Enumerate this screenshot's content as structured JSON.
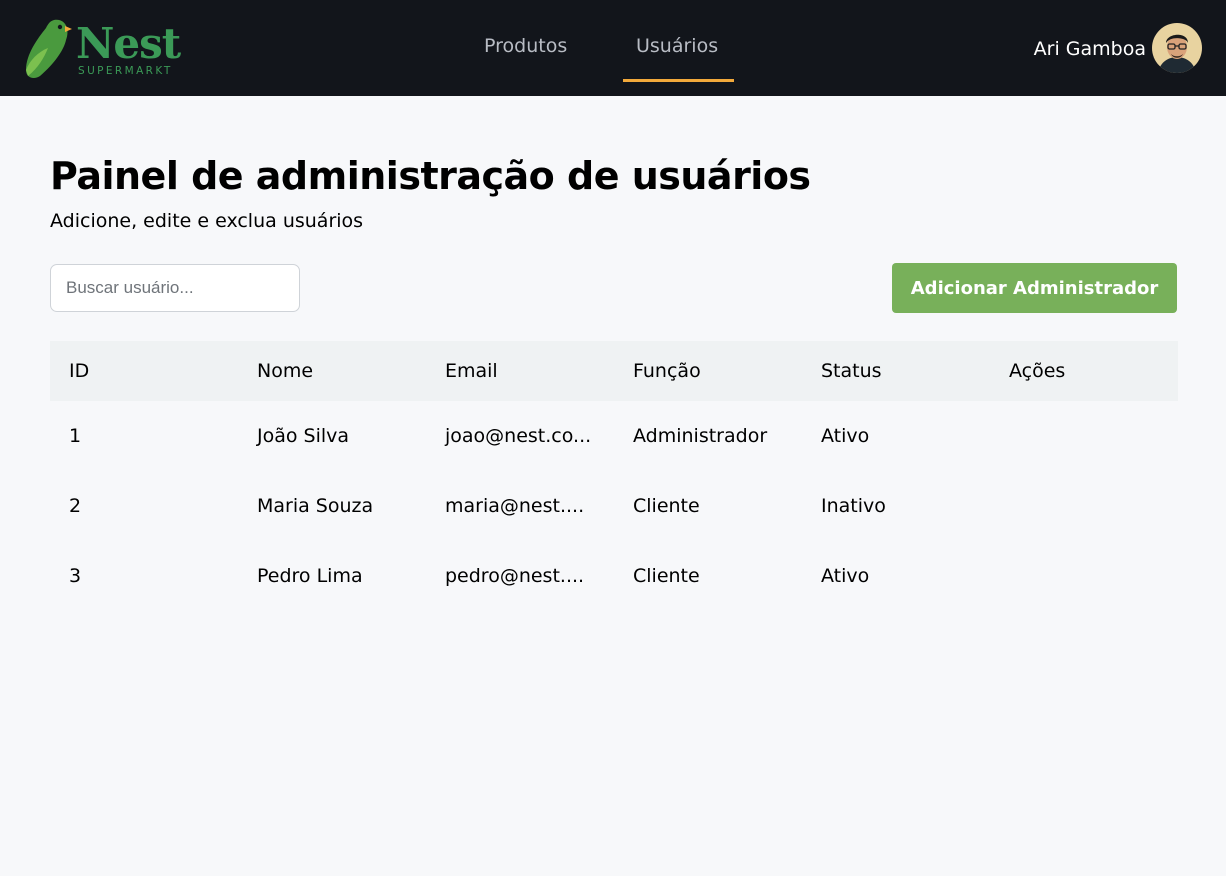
{
  "brand": {
    "name": "Nest",
    "tagline": "SUPERMARKT"
  },
  "nav": {
    "items": [
      {
        "label": "Produtos",
        "active": false
      },
      {
        "label": "Usuários",
        "active": true
      }
    ],
    "active_color": "#f2a93b"
  },
  "user": {
    "name": "Ari Gamboa"
  },
  "page": {
    "title": "Painel de administração de usuários",
    "subtitle": "Adicione, edite e exclua usuários"
  },
  "search": {
    "placeholder": "Buscar usuário...",
    "value": ""
  },
  "actions": {
    "add_admin_label": "Adicionar Administrador",
    "add_admin_color": "#78b05a"
  },
  "table": {
    "columns": [
      "ID",
      "Nome",
      "Email",
      "Função",
      "Status",
      "Ações"
    ],
    "rows": [
      {
        "id": "1",
        "name": "João Silva",
        "email": "joao@nest.co...",
        "role": "Administrador",
        "status": "Ativo",
        "actions": ""
      },
      {
        "id": "2",
        "name": "Maria Souza",
        "email": "maria@nest....",
        "role": "Cliente",
        "status": "Inativo",
        "actions": ""
      },
      {
        "id": "3",
        "name": "Pedro Lima",
        "email": "pedro@nest....",
        "role": "Cliente",
        "status": "Ativo",
        "actions": ""
      }
    ]
  },
  "colors": {
    "header_bg": "#12151b",
    "page_bg": "#f7f8fa",
    "brand_green": "#3b9a57"
  }
}
